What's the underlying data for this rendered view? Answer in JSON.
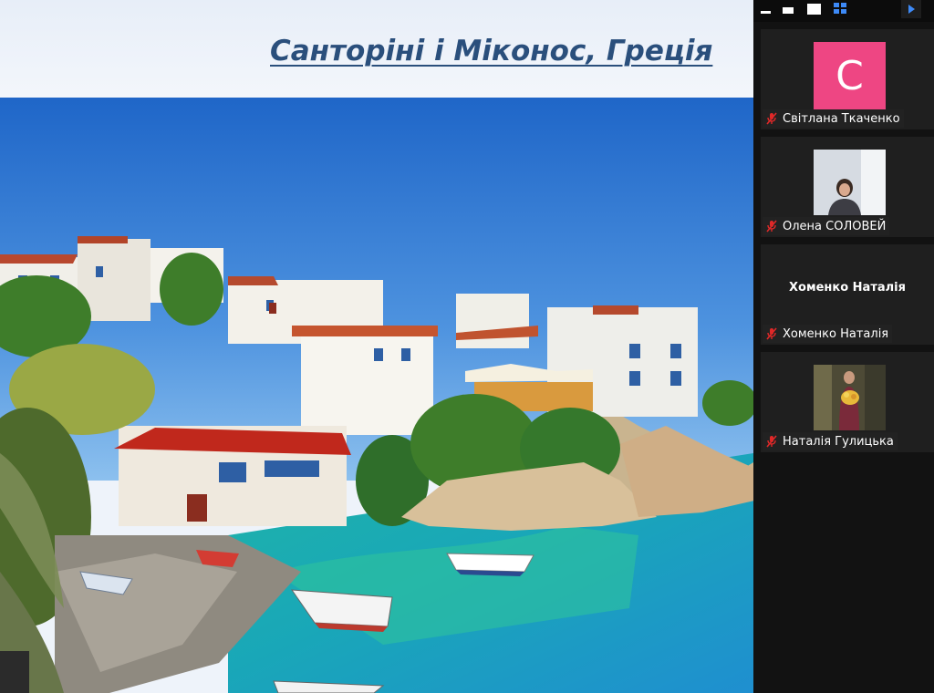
{
  "slide": {
    "title": "Санторіні і Міконос, Греція"
  },
  "gallery": {
    "participants": [
      {
        "name": "Світлана Ткаченко",
        "avatar_letter": "С",
        "avatar_color": "#ee4683",
        "muted": true,
        "mode": "letter"
      },
      {
        "name": "Олена СОЛОВЕЙ",
        "muted": true,
        "mode": "video"
      },
      {
        "name": "Хоменко Наталія",
        "center_name": "Хоменко Наталія",
        "muted": true,
        "mode": "name"
      },
      {
        "name": "Наталія Гулицька",
        "muted": true,
        "mode": "video"
      }
    ],
    "icons": {
      "muted": "mic-muted-icon",
      "toolbar": [
        "minimize-icon",
        "film-strip-icon",
        "fullscreen-icon",
        "grid-view-icon",
        "next-page-icon"
      ]
    }
  },
  "colors": {
    "title": "#2a4f7c",
    "avatar": "#ee4683",
    "mic_muted": "#e02828",
    "accent": "#3d8af7",
    "panel_bg": "#121212",
    "tile_bg": "#1f1f1f"
  }
}
